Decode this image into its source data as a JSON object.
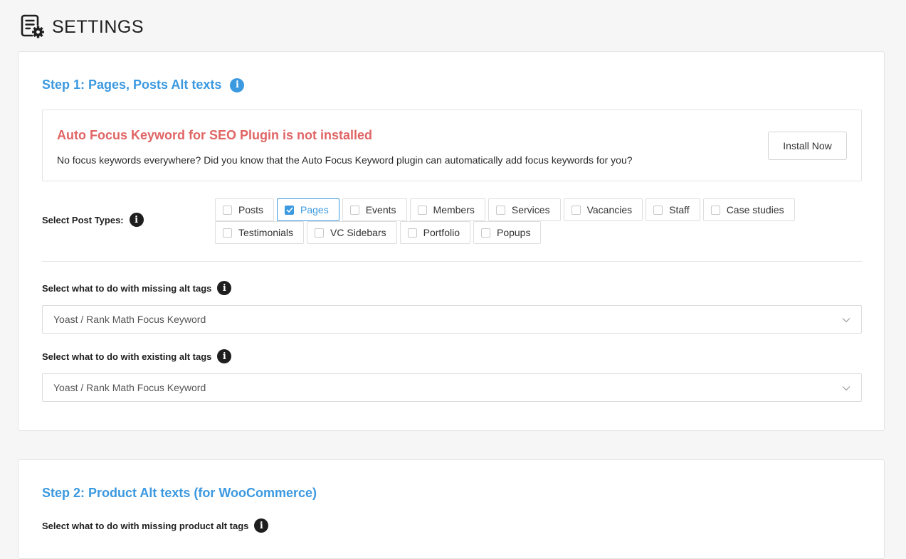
{
  "header": {
    "title": "SETTINGS"
  },
  "step1": {
    "title": "Step 1: Pages, Posts Alt texts",
    "notice": {
      "title": "Auto Focus Keyword for SEO Plugin is not installed",
      "text": "No focus keywords everywhere? Did you know that the Auto Focus Keyword plugin can automatically add focus keywords for you?",
      "button": "Install Now"
    },
    "post_types_label": "Select Post Types:",
    "post_types": [
      {
        "label": "Posts",
        "checked": false
      },
      {
        "label": "Pages",
        "checked": true
      },
      {
        "label": "Events",
        "checked": false
      },
      {
        "label": "Members",
        "checked": false
      },
      {
        "label": "Services",
        "checked": false
      },
      {
        "label": "Vacancies",
        "checked": false
      },
      {
        "label": "Staff",
        "checked": false
      },
      {
        "label": "Case studies",
        "checked": false
      },
      {
        "label": "Testimonials",
        "checked": false
      },
      {
        "label": "VC Sidebars",
        "checked": false
      },
      {
        "label": "Portfolio",
        "checked": false
      },
      {
        "label": "Popups",
        "checked": false
      }
    ],
    "missing_label": "Select what to do with missing alt tags",
    "missing_value": "Yoast / Rank Math Focus Keyword",
    "existing_label": "Select what to do with existing alt tags",
    "existing_value": "Yoast / Rank Math Focus Keyword"
  },
  "step2": {
    "title": "Step 2: Product Alt texts (for WooCommerce)",
    "missing_product_label": "Select what to do with missing product alt tags"
  },
  "colors": {
    "accent": "#3b99e0",
    "warning": "#e06565",
    "dark": "#1e1e1e"
  },
  "icons": {
    "header": "settings-document-icon",
    "info": "info-icon",
    "dropdown": "chevron-down-icon",
    "check": "checkmark-icon"
  }
}
